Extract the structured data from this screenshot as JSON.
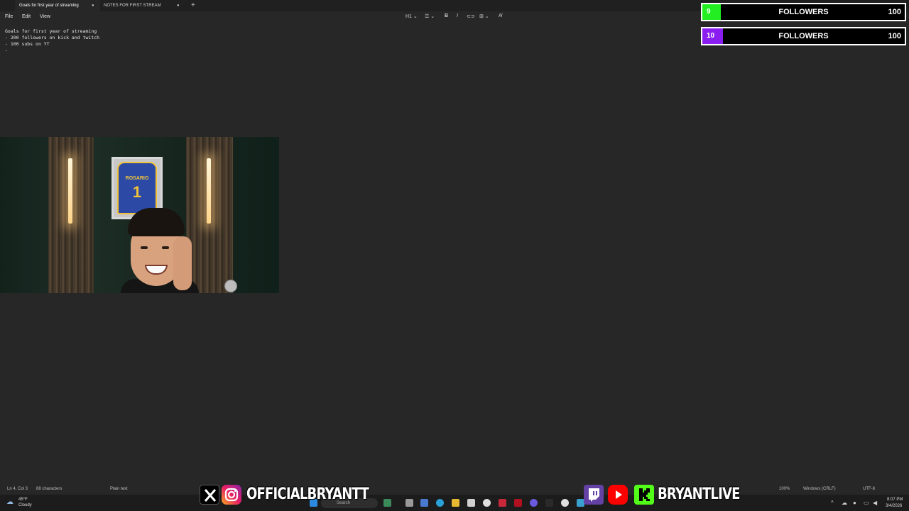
{
  "tabs": [
    {
      "label": "Goals for first year of streaming",
      "active": true
    },
    {
      "label": "NOTES FOR FIRST STREAM",
      "active": false
    }
  ],
  "menu": {
    "file": "File",
    "edit": "Edit",
    "view": "View"
  },
  "toolbar": {
    "heading": "H1"
  },
  "document": {
    "lines": [
      "Goals for first year of streaming",
      "- 200 followers on kick and twitch",
      "- 100 subs on YT",
      "-"
    ]
  },
  "goals": [
    {
      "count": "9",
      "label": "FOLLOWERS",
      "target": "100",
      "color": "#22ee22",
      "progress": 0.09
    },
    {
      "count": "10",
      "label": "FOLLOWERS",
      "target": "100",
      "color": "#8a1ef0",
      "progress": 0.1
    }
  ],
  "jersey": {
    "name": "ROSARIO",
    "number": "1"
  },
  "statusbar": {
    "position": "Ln 4, Col 3",
    "characters": "88 characters",
    "format": "Plain text",
    "zoom": "100%",
    "line_ending": "Windows (CRLF)",
    "encoding": "UTF-8"
  },
  "weather": {
    "temp": "45°F",
    "condition": "Cloudy"
  },
  "taskbar": {
    "search": "Search"
  },
  "clock": {
    "time": "8:07 PM",
    "date": "3/4/2026"
  },
  "social": {
    "left_handle": "OFFICIALBRYANTT",
    "right_handle": "BRYANTLIVE"
  }
}
